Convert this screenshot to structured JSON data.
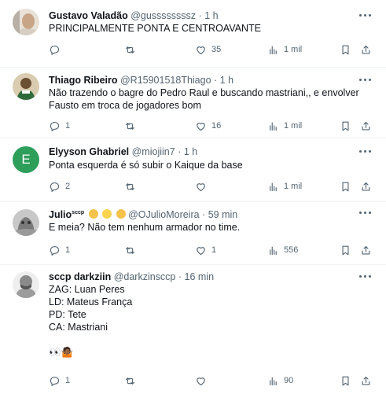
{
  "tweets": [
    {
      "name": "Gustavo Valadão",
      "handle": "@gussssssssz",
      "time": "1 h",
      "lines": [
        "PRINCIPALMENTE PONTA E CENTROAVANTE"
      ],
      "replies": "",
      "retweets": "",
      "likes": "35",
      "views": "1 mil"
    },
    {
      "name": "Thiago Ribeiro",
      "handle": "@R15901518Thiago",
      "time": "1 h",
      "lines": [
        "Não trazendo o bagre do Pedro Raul e buscando mastriani,, e envolver",
        "Fausto em troca de jogadores bom"
      ],
      "replies": "1",
      "retweets": "",
      "likes": "16",
      "views": "1 mil"
    },
    {
      "name": "Elyyson Ghabriel",
      "handle": "@miojiin7",
      "time": "1 h",
      "avatar_letter": "E",
      "lines": [
        "Ponta esquerda é só subir o Kaique da base"
      ],
      "replies": "2",
      "retweets": "",
      "likes": "",
      "views": "1 mil"
    },
    {
      "name": "Julio",
      "name_suffix": "sccp",
      "handle": "@OJulioMoreira",
      "time": "59 min",
      "lines": [
        "E meia? Não tem nenhum armador no time."
      ],
      "replies": "1",
      "retweets": "",
      "likes": "1",
      "views": "556"
    },
    {
      "name": "sccp darkziin",
      "handle": "@darkzinsccp",
      "time": "16 min",
      "lines": [
        "ZAG: Luan Peres",
        "LD: Mateus França",
        "PD: Tete",
        "CA: Mastriani",
        "",
        "👀🤷🏾"
      ],
      "replies": "1",
      "retweets": "",
      "likes": "",
      "views": "90"
    }
  ],
  "dot": "·",
  "colors": {
    "text": "#0f1419",
    "secondary": "#536471",
    "divider": "#eff3f4",
    "avatar_e": "#2e9e5b"
  }
}
